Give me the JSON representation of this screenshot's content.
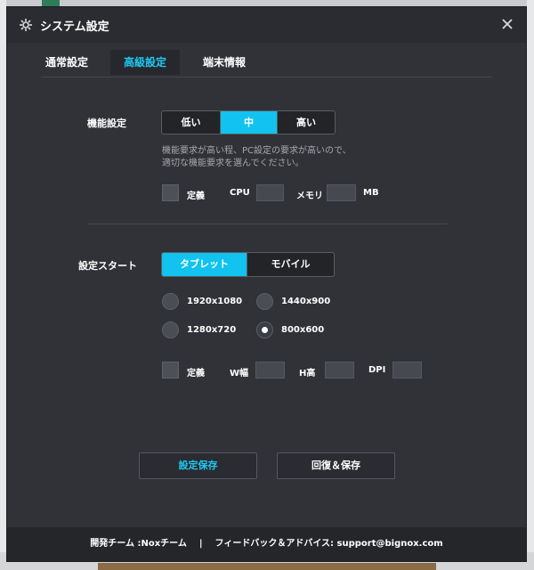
{
  "window": {
    "title": "システム設定",
    "close_label": "×"
  },
  "tabs": [
    {
      "label": "通常設定",
      "active": false
    },
    {
      "label": "高級設定",
      "active": true
    },
    {
      "label": "端末情報",
      "active": false
    }
  ],
  "performance": {
    "label": "機能設定",
    "options": [
      "低い",
      "中",
      "高い"
    ],
    "selected": "中",
    "hint_line1": "機能要求が高い程、PC設定の要求が高いので、",
    "hint_line2": "適切な機能要求を選んでください。",
    "custom_label": "定義",
    "cpu_label": "CPU",
    "cpu_value": "",
    "memory_label": "メモリ",
    "memory_value": "",
    "memory_unit": "MB"
  },
  "startup": {
    "label": "設定スタート",
    "options": [
      "タブレット",
      "モバイル"
    ],
    "selected": "タブレット",
    "resolutions": [
      {
        "label": "1920x1080",
        "checked": false
      },
      {
        "label": "1440x900",
        "checked": false
      },
      {
        "label": "1280x720",
        "checked": false
      },
      {
        "label": "800x600",
        "checked": true
      }
    ],
    "custom_label": "定義",
    "width_label": "W幅",
    "width_value": "",
    "height_label": "H高",
    "height_value": "",
    "dpi_label": "DPI",
    "dpi_value": ""
  },
  "buttons": {
    "save": "設定保存",
    "restore": "回復＆保存"
  },
  "footer": {
    "team": "開発チーム :Noxチーム",
    "separator": "|",
    "feedback": "フィードバック＆アドバイス: support@bignox.com"
  },
  "colors": {
    "accent": "#11c3ee",
    "dialog_bg": "#303238",
    "text": "#ffffff"
  }
}
